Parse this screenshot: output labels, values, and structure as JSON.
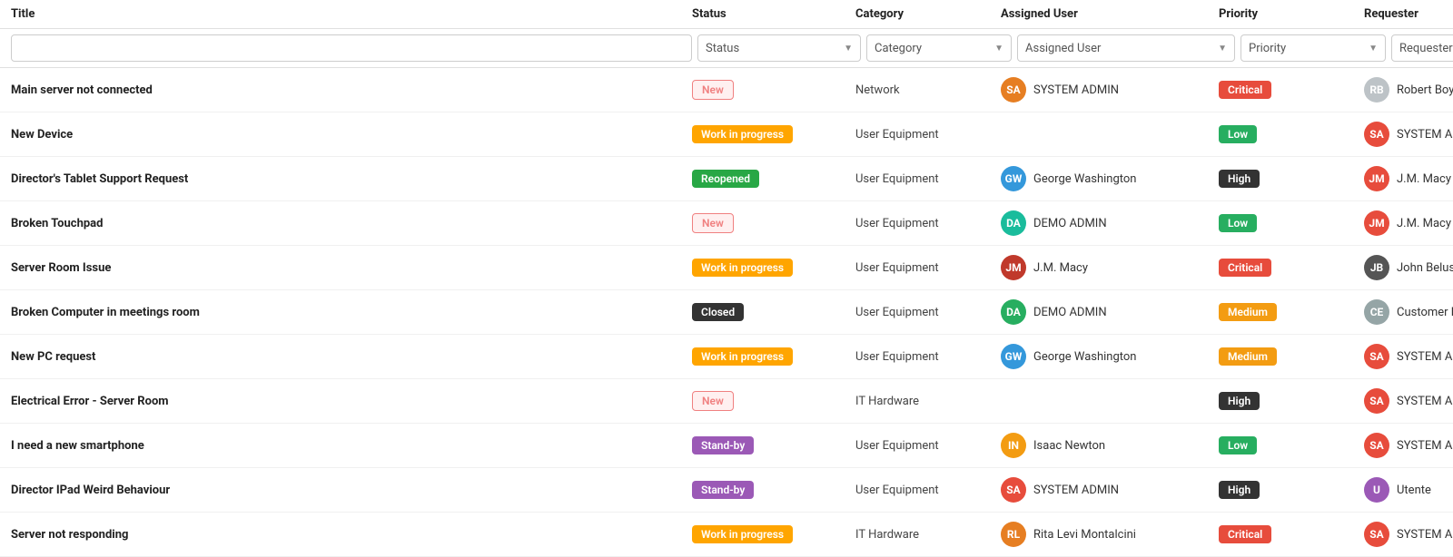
{
  "columns": {
    "title": "Title",
    "status": "Status",
    "category": "Category",
    "assigned_user": "Assigned User",
    "priority": "Priority",
    "requester": "Requester"
  },
  "filters": {
    "title_placeholder": "",
    "status_placeholder": "Status",
    "category_placeholder": "Category",
    "assigned_placeholder": "Assigned User",
    "priority_placeholder": "Priority",
    "requester_placeholder": "Requester"
  },
  "rows": [
    {
      "title": "Main server not connected",
      "status": "New",
      "status_type": "new",
      "category": "Network",
      "assigned_name": "SYSTEM ADMIN",
      "assigned_color": "#e67e22",
      "assigned_initials": "SA",
      "has_avatar": true,
      "avatar_color": "#e67e22",
      "priority": "Critical",
      "priority_type": "critical",
      "requester_name": "Robert Boyl",
      "requester_color": "#bdc3c7",
      "requester_initials": "RB"
    },
    {
      "title": "New Device",
      "status": "Work in progress",
      "status_type": "wip",
      "category": "User Equipment",
      "assigned_name": "",
      "assigned_color": "",
      "assigned_initials": "",
      "has_avatar": false,
      "avatar_color": "",
      "priority": "Low",
      "priority_type": "low",
      "requester_name": "SYSTEM AD",
      "requester_color": "#e74c3c",
      "requester_initials": "SA"
    },
    {
      "title": "Director's Tablet Support Request",
      "status": "Reopened",
      "status_type": "reopened",
      "category": "User Equipment",
      "assigned_name": "George Washington",
      "assigned_color": "#3498db",
      "assigned_initials": "GW",
      "has_avatar": true,
      "avatar_color": "#3498db",
      "priority": "High",
      "priority_type": "high",
      "requester_name": "J.M. Macy",
      "requester_color": "#e74c3c",
      "requester_initials": "JM"
    },
    {
      "title": "Broken Touchpad",
      "status": "New",
      "status_type": "new",
      "category": "User Equipment",
      "assigned_name": "DEMO ADMIN",
      "assigned_color": "#1abc9c",
      "assigned_initials": "DA",
      "has_avatar": true,
      "avatar_color": "#1abc9c",
      "priority": "Low",
      "priority_type": "low",
      "requester_name": "J.M. Macy",
      "requester_color": "#e74c3c",
      "requester_initials": "JM"
    },
    {
      "title": "Server Room Issue",
      "status": "Work in progress",
      "status_type": "wip",
      "category": "User Equipment",
      "assigned_name": "J.M. Macy",
      "assigned_color": "#c0392b",
      "assigned_initials": "JM",
      "has_avatar": true,
      "avatar_color": "#c0392b",
      "priority": "Critical",
      "priority_type": "critical",
      "requester_name": "John Belush",
      "requester_color": "#555",
      "requester_initials": "JB"
    },
    {
      "title": "Broken Computer in meetings room",
      "status": "Closed",
      "status_type": "closed",
      "category": "User Equipment",
      "assigned_name": "DEMO ADMIN",
      "assigned_color": "#27ae60",
      "assigned_initials": "DA",
      "has_avatar": true,
      "avatar_color": "#27ae60",
      "priority": "Medium",
      "priority_type": "medium",
      "requester_name": "Customer E",
      "requester_color": "#95a5a6",
      "requester_initials": "CE"
    },
    {
      "title": "New PC request",
      "status": "Work in progress",
      "status_type": "wip",
      "category": "User Equipment",
      "assigned_name": "George Washington",
      "assigned_color": "#3498db",
      "assigned_initials": "GW",
      "has_avatar": true,
      "avatar_color": "#3498db",
      "priority": "Medium",
      "priority_type": "medium",
      "requester_name": "SYSTEM AD",
      "requester_color": "#e74c3c",
      "requester_initials": "SA"
    },
    {
      "title": "Electrical Error - Server Room",
      "status": "New",
      "status_type": "new",
      "category": "IT Hardware",
      "assigned_name": "",
      "assigned_color": "",
      "assigned_initials": "",
      "has_avatar": false,
      "avatar_color": "",
      "priority": "High",
      "priority_type": "high",
      "requester_name": "SYSTEM AD",
      "requester_color": "#e74c3c",
      "requester_initials": "SA"
    },
    {
      "title": "I need a new smartphone",
      "status": "Stand-by",
      "status_type": "standby",
      "category": "User Equipment",
      "assigned_name": "Isaac Newton",
      "assigned_color": "#f39c12",
      "assigned_initials": "IN",
      "has_avatar": true,
      "avatar_color": "#f39c12",
      "priority": "Low",
      "priority_type": "low",
      "requester_name": "SYSTEM AD",
      "requester_color": "#e74c3c",
      "requester_initials": "SA"
    },
    {
      "title": "Director IPad Weird Behaviour",
      "status": "Stand-by",
      "status_type": "standby",
      "category": "User Equipment",
      "assigned_name": "SYSTEM ADMIN",
      "assigned_color": "#e74c3c",
      "assigned_initials": "SA",
      "has_avatar": true,
      "avatar_color": "#e74c3c",
      "priority": "High",
      "priority_type": "high",
      "requester_name": "Utente",
      "requester_color": "#9b59b6",
      "requester_initials": "U"
    },
    {
      "title": "Server not responding",
      "status": "Work in progress",
      "status_type": "wip",
      "category": "IT Hardware",
      "assigned_name": "Rita Levi Montalcini",
      "assigned_color": "#e67e22",
      "assigned_initials": "RL",
      "has_avatar": true,
      "avatar_color": "#e67e22",
      "priority": "Critical",
      "priority_type": "critical",
      "requester_name": "SYSTEM AD",
      "requester_color": "#e74c3c",
      "requester_initials": "SA"
    }
  ]
}
